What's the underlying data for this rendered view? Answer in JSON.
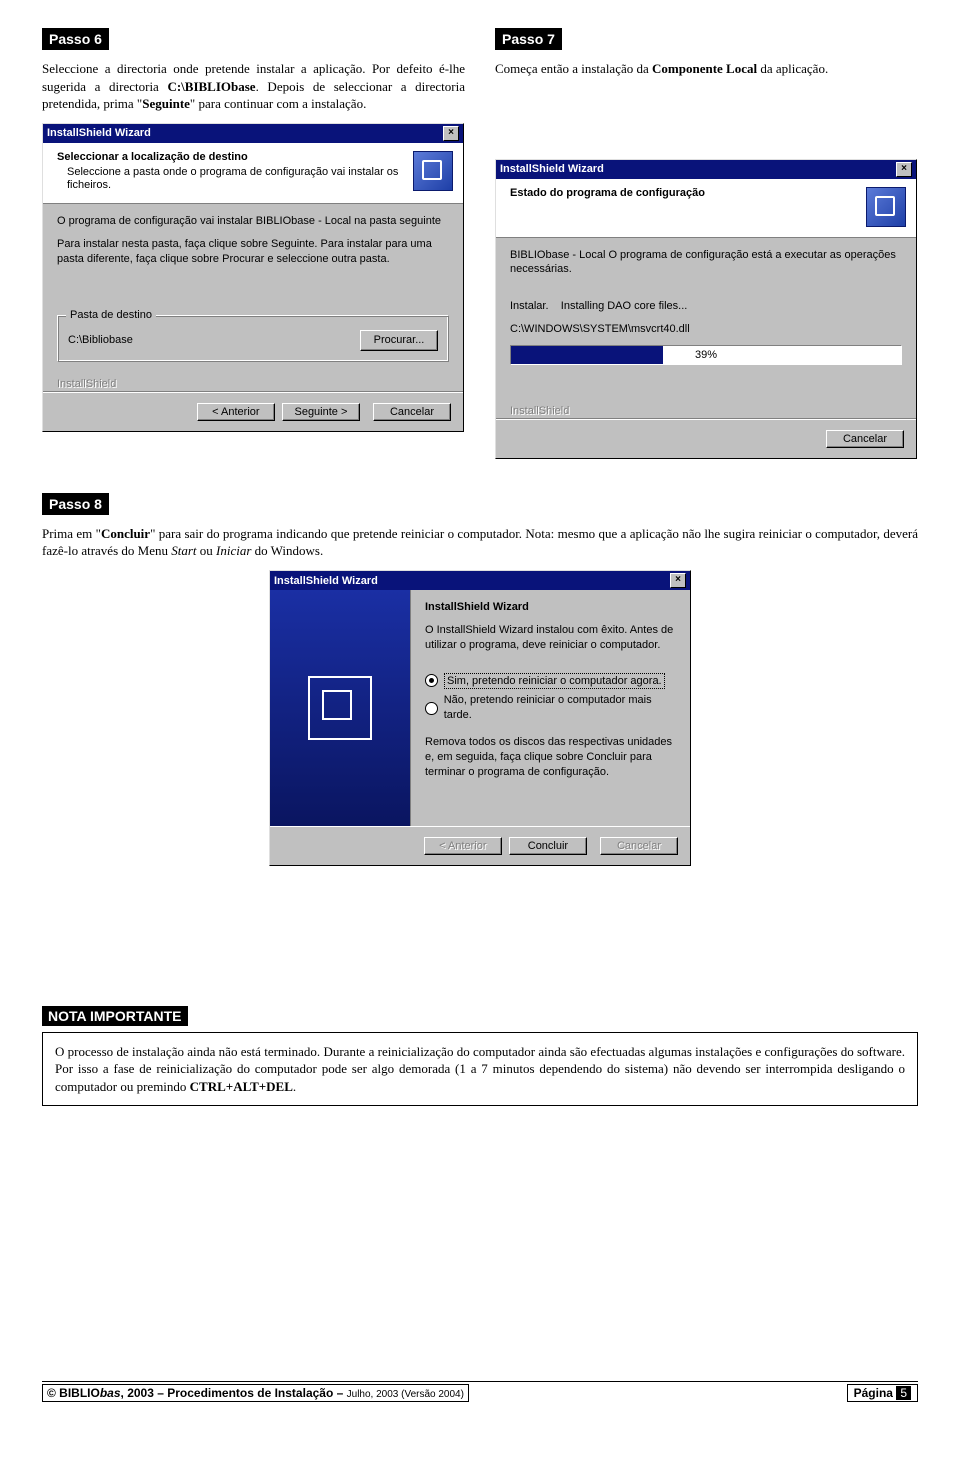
{
  "step6": {
    "badge": "Passo  6",
    "para1": "Seleccione a directoria onde pretende instalar a aplicação. Por defeito é-lhe sugerida a directoria ",
    "path": "C:\\BIBLIObase",
    "para2": ". Depois de seleccionar a directoria pretendida, prima \"",
    "bold2": "Seguinte",
    "para3": "\" para continuar com a instalação."
  },
  "step7": {
    "badge": "Passo  7",
    "para1": "Começa então a instalação da ",
    "bold1": "Componente Local",
    "para2": " da aplicação."
  },
  "dlg1": {
    "title": "InstallShield Wizard",
    "h1": "Seleccionar a localização de destino",
    "h2": "Seleccione a pasta onde o programa de configuração vai instalar os ficheiros.",
    "p1": "O programa de configuração vai instalar BIBLIObase - Local na pasta seguinte",
    "p2": "Para instalar nesta pasta, faça clique sobre Seguinte. Para instalar para uma pasta diferente, faça clique sobre Procurar e seleccione outra pasta.",
    "grp_legend": "Pasta de destino",
    "grp_path": "C:\\Bibliobase",
    "btn_browse": "Procurar...",
    "brand": "InstallShield",
    "btn_back": "< Anterior",
    "btn_next": "Seguinte >",
    "btn_cancel": "Cancelar"
  },
  "dlg2": {
    "title": "InstallShield Wizard",
    "h1": "Estado do programa de configuração",
    "p1": "BIBLIObase - Local O programa de configuração está a executar as operações necessárias.",
    "p2a": "Instalar.",
    "p2b": "Installing DAO core files...",
    "p3": "C:\\WINDOWS\\SYSTEM\\msvcrt40.dll",
    "progress": "39%",
    "brand": "InstallShield",
    "btn_cancel": "Cancelar"
  },
  "step8": {
    "badge": "Passo  8",
    "para1": "Prima em \"",
    "bold1": "Concluir",
    "para2": "\" para sair do programa indicando que pretende reiniciar o computador. Nota: mesmo que a aplicação não lhe sugira reiniciar o computador, deverá fazê-lo através do Menu ",
    "it1": "Start",
    "para3": " ou ",
    "it2": "Iniciar",
    "para4": " do Windows."
  },
  "dlg3": {
    "title": "InstallShield Wizard",
    "h1": "InstallShield Wizard",
    "p1": "O InstallShield Wizard instalou com êxito. Antes de utilizar o programa, deve reiniciar o computador.",
    "opt1": "Sim, pretendo reiniciar o computador agora.",
    "opt2": "Não, pretendo reiniciar o computador mais tarde.",
    "p2": "Remova todos os discos das respectivas unidades e, em seguida, faça clique sobre Concluir para terminar o programa de configuração.",
    "btn_back": "< Anterior",
    "btn_finish": "Concluir",
    "btn_cancel": "Cancelar"
  },
  "note": {
    "title": "NOTA IMPORTANTE",
    "body1": "O processo de instalação ainda não está terminado. Durante a reinicialização do computador ainda são efectuadas algumas instalações e configurações do software. Por isso a fase de reinicialização do computador pode ser algo demorada (1 a 7 minutos dependendo do sistema) não devendo ser interrompida desligando o computador ou premindo ",
    "bold1": "CTRL+ALT+DEL",
    "body2": "."
  },
  "footer": {
    "copyright_prefix": "© BIBLIO",
    "copyright_italic": "bas",
    "copyright_suffix": ", 2003 – Procedimentos de Instalação – ",
    "copyright_small": "Julho, 2003 (Versão 2004)",
    "page_label": "Página ",
    "page_num": "5"
  }
}
